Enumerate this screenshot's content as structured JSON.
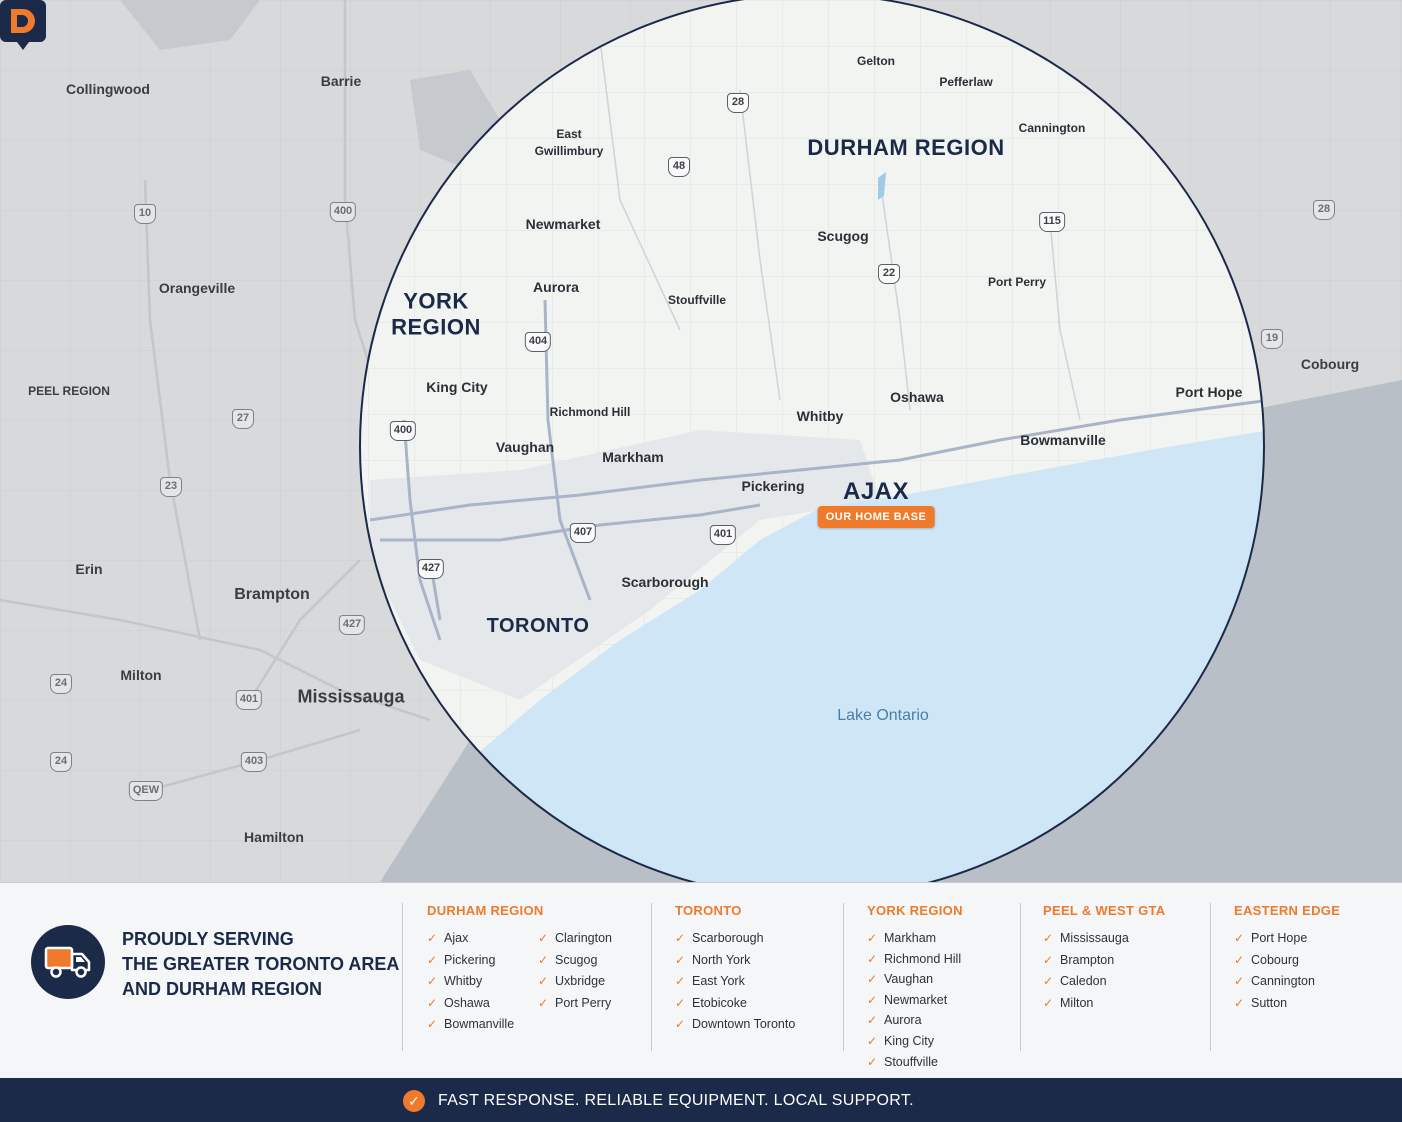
{
  "map": {
    "colors": {
      "land_outside": "#d8d9db",
      "land_inside": "#f2f4f2",
      "water": "#cfe6f6",
      "circle_border": "#1b2a48",
      "accent": "#ef7a2b"
    },
    "regions": {
      "durham": "DURHAM REGION",
      "york_line1": "YORK",
      "york_line2": "REGION",
      "peel": "PEEL REGION",
      "toronto": "TORONTO"
    },
    "lake": "Lake Ontario",
    "places": {
      "collingwood": "Collingwood",
      "barrie": "Barrie",
      "orangeville": "Orangeville",
      "erin": "Erin",
      "brampton": "Brampton",
      "milton": "Milton",
      "mississauga": "Mississauga",
      "hamilton": "Hamilton",
      "cobourg": "Cobourg",
      "gelton": "Gelton",
      "pefferlaw": "Pefferlaw",
      "cannington": "Cannington",
      "east_gwillimbury_1": "East",
      "east_gwillimbury_2": "Gwillimbury",
      "newmarket": "Newmarket",
      "scugog": "Scugog",
      "aurora": "Aurora",
      "stouffville": "Stouffville",
      "port_perry": "Port Perry",
      "king_city": "King City",
      "richmond_hill": "Richmond Hill",
      "whitby": "Whitby",
      "oshawa": "Oshawa",
      "port_hope": "Port Hope",
      "vaughan": "Vaughan",
      "markham": "Markham",
      "bowmanville": "Bowmanville",
      "pickering": "Pickering",
      "scarborough": "Scarborough"
    },
    "shields": {
      "s28a": "28",
      "s48": "48",
      "s115": "115",
      "s22": "22",
      "s404": "404",
      "s400a": "400",
      "s407": "407",
      "s401": "401",
      "s427a": "427",
      "s10": "10",
      "s400b": "400",
      "s27": "27",
      "s23": "23",
      "s427b": "427",
      "s401b": "401",
      "s403": "403",
      "sqew": "QEW",
      "s24a": "24",
      "s24b": "24",
      "s28b": "28",
      "s19": "19"
    },
    "home": {
      "icon": "d-logo-pin-icon",
      "name": "AJAX",
      "badge": "OUR HOME BASE"
    }
  },
  "panel": {
    "icon": "delivery-truck-icon",
    "tagline": [
      "PROUDLY SERVING",
      "THE GREATER TORONTO AREA",
      "AND DURHAM REGION"
    ],
    "columns": [
      {
        "title": "DURHAM REGION",
        "items": [
          "Ajax",
          "Pickering",
          "Whitby",
          "Oshawa",
          "Bowmanville"
        ],
        "items2": [
          "Clarington",
          "Scugog",
          "Uxbridge",
          "Port Perry"
        ]
      },
      {
        "title": "TORONTO",
        "items": [
          "Scarborough",
          "North York",
          "East York",
          "Etobicoke",
          "Downtown Toronto"
        ]
      },
      {
        "title": "YORK REGION",
        "items": [
          "Markham",
          "Richmond Hill",
          "Vaughan",
          "Newmarket",
          "Aurora",
          "King City",
          "Stouffville"
        ]
      },
      {
        "title": "PEEL & WEST GTA",
        "items": [
          "Mississauga",
          "Brampton",
          "Caledon",
          "Milton"
        ]
      },
      {
        "title": "EASTERN EDGE",
        "items": [
          "Port Hope",
          "Cobourg",
          "Cannington",
          "Sutton"
        ]
      }
    ]
  },
  "footer": {
    "icon": "check-circle-icon",
    "text": "FAST RESPONSE. RELIABLE EQUIPMENT. LOCAL SUPPORT."
  }
}
